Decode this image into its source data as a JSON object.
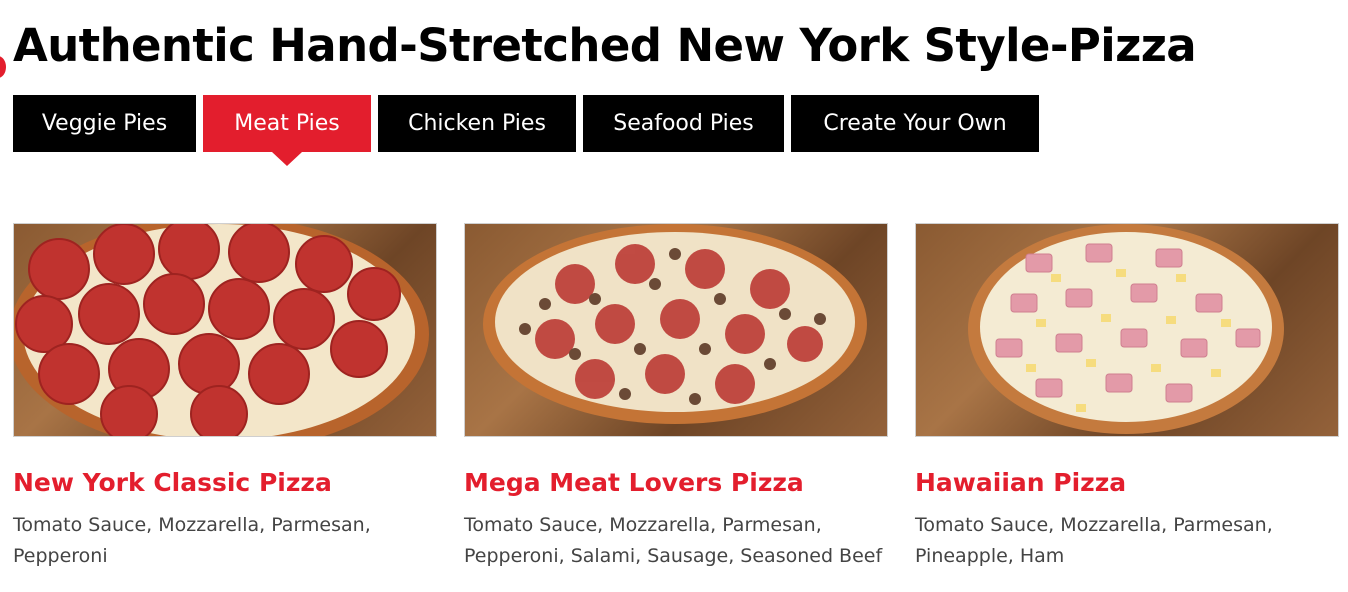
{
  "page_title": "Authentic Hand-Stretched New York Style-Pizza",
  "tabs": [
    {
      "label": "Veggie Pies",
      "active": false
    },
    {
      "label": "Meat Pies",
      "active": true
    },
    {
      "label": "Chicken Pies",
      "active": false
    },
    {
      "label": "Seafood Pies",
      "active": false
    },
    {
      "label": "Create Your Own",
      "active": false
    }
  ],
  "products": [
    {
      "name": "New York Classic Pizza",
      "ingredients_line1": "Tomato Sauce, Mozzarella, Parmesan,",
      "ingredients_line2": "Pepperoni",
      "image": "pepperoni-pizza-photo"
    },
    {
      "name": "Mega Meat Lovers Pizza",
      "ingredients_line1": "Tomato Sauce, Mozzarella, Parmesan,",
      "ingredients_line2": "Pepperoni, Salami, Sausage, Seasoned Beef",
      "image": "meat-lovers-pizza-photo"
    },
    {
      "name": "Hawaiian Pizza",
      "ingredients_line1": "Tomato Sauce, Mozzarella, Parmesan,",
      "ingredients_line2": "Pineapple, Ham",
      "image": "hawaiian-pizza-photo"
    }
  ],
  "colors": {
    "accent": "#e31e2d",
    "tab_background": "#000000",
    "tab_text": "#ffffff",
    "body_text": "#444444"
  }
}
